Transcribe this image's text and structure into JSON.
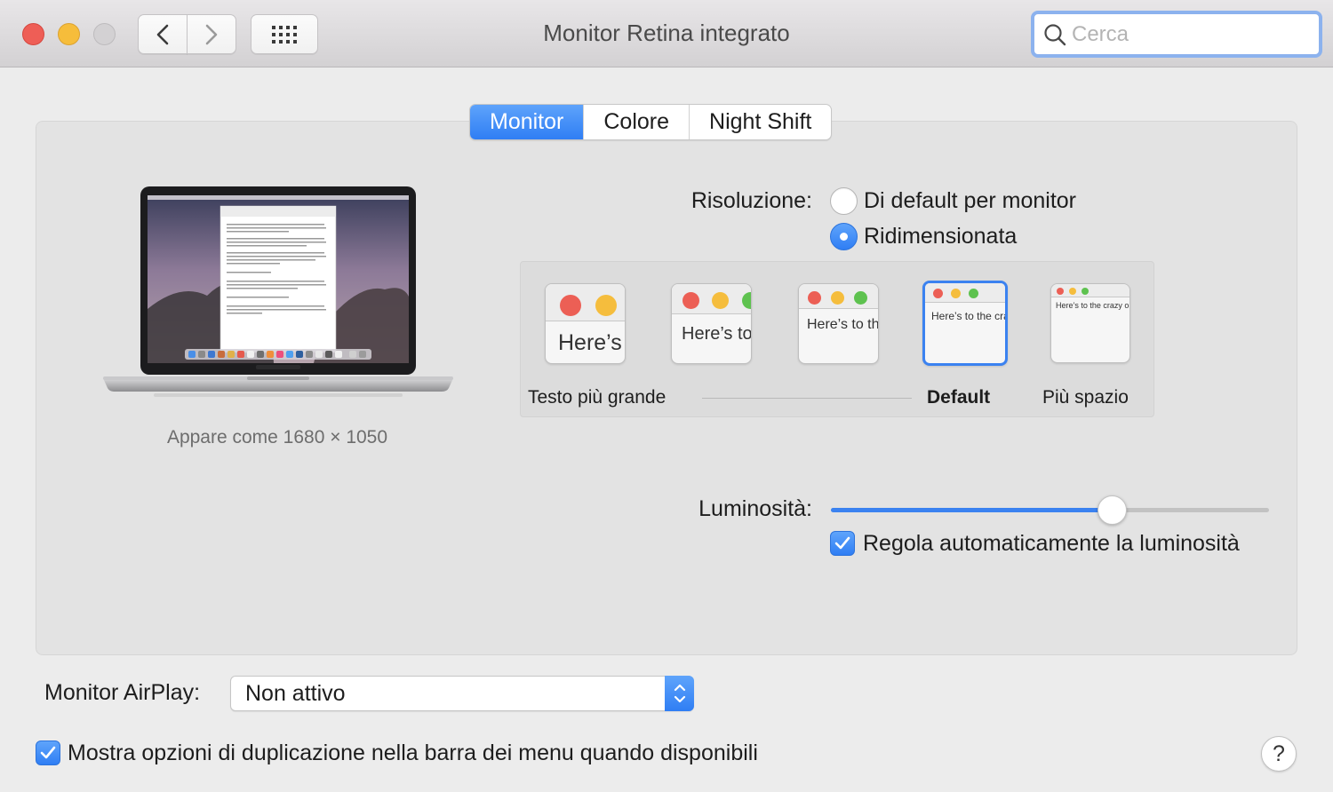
{
  "window": {
    "title": "Monitor Retina integrato",
    "search_placeholder": "Cerca",
    "icons": {
      "back": "chevron-left-icon",
      "forward": "chevron-right-icon",
      "show_all": "grid-icon",
      "search": "magnifier-icon"
    }
  },
  "tabs": [
    {
      "label": "Monitor",
      "active": true
    },
    {
      "label": "Colore",
      "active": false
    },
    {
      "label": "Night Shift",
      "active": false
    }
  ],
  "display": {
    "caption": "Appare come 1680 × 1050"
  },
  "resolution": {
    "label": "Risoluzione:",
    "options": [
      {
        "label": "Di default per monitor",
        "selected": false
      },
      {
        "label": "Ridimensionata",
        "selected": true
      }
    ],
    "scaled_thumb_text": "Here’s to the crazy ones.",
    "scale_labels": {
      "larger": "Testo più grande",
      "default": "Default",
      "more_space": "Più spazio"
    },
    "selected_scale_index": 3
  },
  "brightness": {
    "label": "Luminosità:",
    "value": 0.64,
    "auto_label": "Regola automaticamente la luminosità",
    "auto_checked": true
  },
  "airplay": {
    "label": "Monitor AirPlay:",
    "value": "Non attivo"
  },
  "mirroring": {
    "label": "Mostra opzioni di duplicazione nella barra dei menu quando disponibili",
    "checked": true
  },
  "help": {
    "label": "?"
  },
  "colors": {
    "accent": "#3b82f0",
    "close": "#ee5e56",
    "minimize": "#f6bd3b",
    "zoom_disabled": "#d3d1d3"
  }
}
